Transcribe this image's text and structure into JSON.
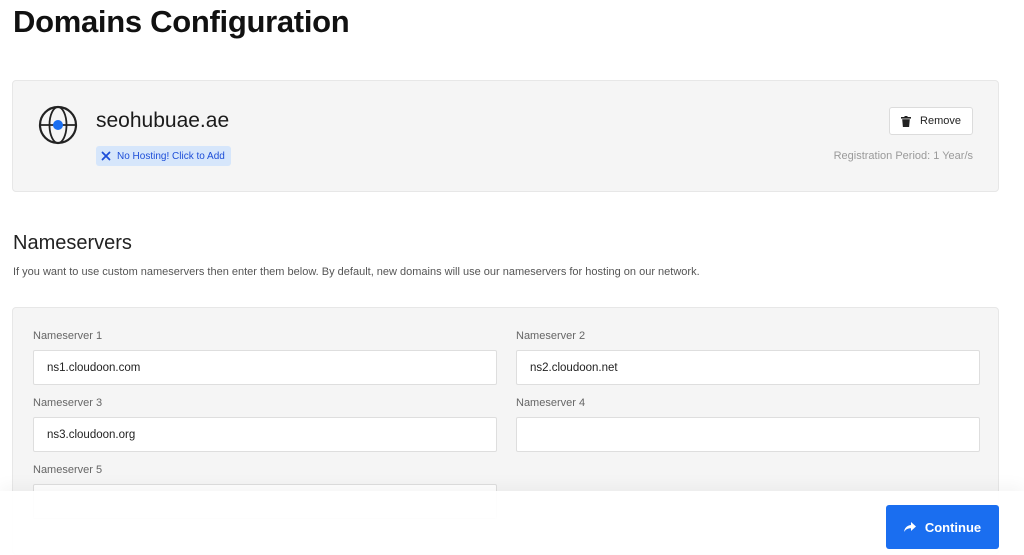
{
  "page": {
    "title": "Domains Configuration"
  },
  "domain": {
    "name": "seohubuae.ae",
    "hosting_badge": "No Hosting! Click to Add",
    "remove_label": "Remove",
    "registration_period": "Registration Period: 1 Year/s",
    "icon": "globe-icon"
  },
  "nameservers": {
    "heading": "Nameservers",
    "description": "If you want to use custom nameservers then enter them below. By default, new domains will use our nameservers for hosting on our network.",
    "fields": [
      {
        "label": "Nameserver 1",
        "value": "ns1.cloudoon.com"
      },
      {
        "label": "Nameserver 2",
        "value": "ns2.cloudoon.net"
      },
      {
        "label": "Nameserver 3",
        "value": "ns3.cloudoon.org"
      },
      {
        "label": "Nameserver 4",
        "value": ""
      },
      {
        "label": "Nameserver 5",
        "value": ""
      }
    ]
  },
  "actions": {
    "continue_label": "Continue"
  },
  "colors": {
    "accent": "#1a6ef0",
    "badge_bg": "#d6e6fb",
    "panel_bg": "#f5f5f5"
  }
}
